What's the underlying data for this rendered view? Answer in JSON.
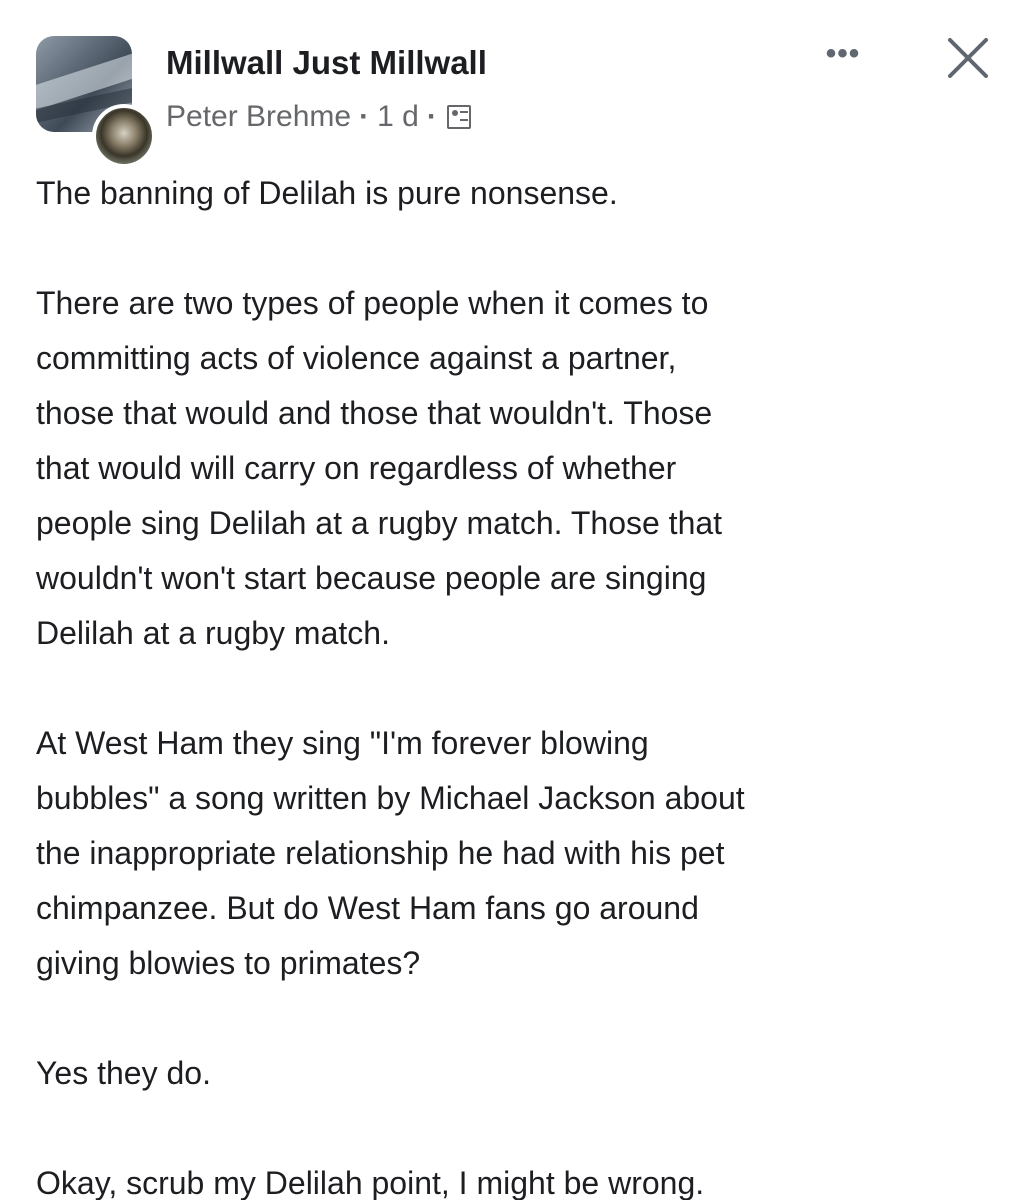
{
  "post": {
    "group_name": "Millwall Just Millwall",
    "author": "Peter Brehme",
    "separator": "·",
    "time": "1 d",
    "privacy_icon": "members-icon",
    "more_icon": "more-options-icon",
    "more_label": "•••",
    "close_icon": "close-icon",
    "paragraphs": [
      "The banning of Delilah is pure nonsense.",
      "There are two types of people when it comes to\ncommitting acts of violence against a partner,\nthose that would and those that wouldn't. Those\nthat would will carry on regardless of whether\npeople sing Delilah at a rugby match. Those that\nwouldn't won't start because people are singing\nDelilah at a rugby match.",
      "At West Ham they sing \"I'm forever blowing\nbubbles\" a song written by Michael Jackson about\nthe inappropriate relationship he had with his pet\nchimpanzee. But do West Ham fans go around\ngiving blowies to primates?",
      "Yes they do.",
      "Okay, scrub my Delilah point, I might be wrong."
    ]
  },
  "colors": {
    "text": "#1c1e21",
    "secondary_text": "#65676b",
    "background": "#ffffff"
  }
}
